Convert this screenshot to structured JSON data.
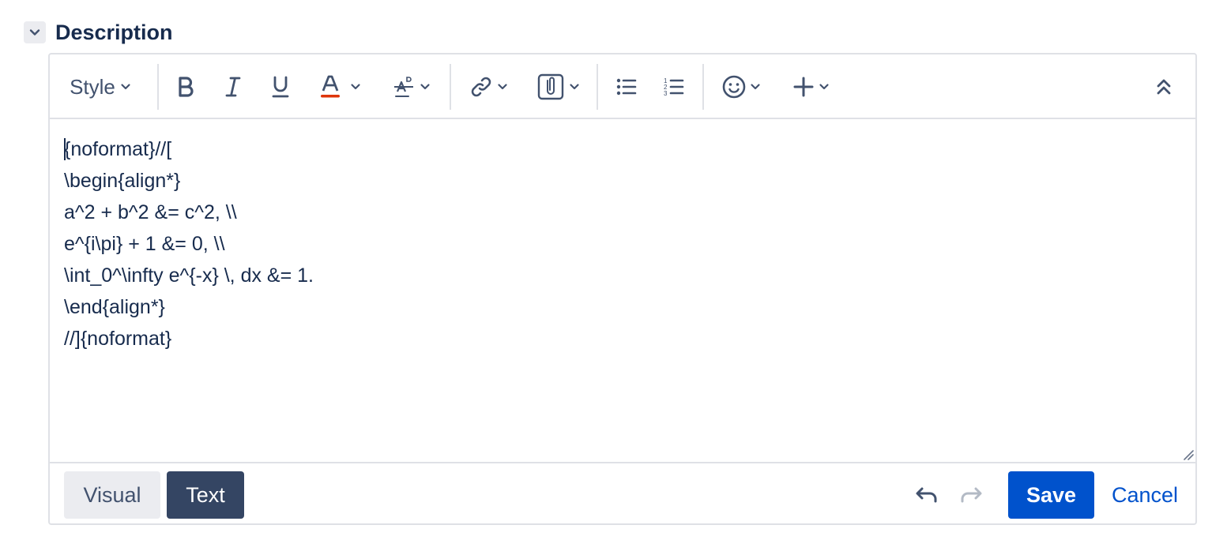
{
  "section": {
    "title": "Description",
    "toggle_icon": "chevron-down-icon"
  },
  "toolbar": {
    "style_label": "Style",
    "items": [
      {
        "name": "bold",
        "icon": "bold-icon"
      },
      {
        "name": "italic",
        "icon": "italic-icon"
      },
      {
        "name": "underline",
        "icon": "underline-icon"
      },
      {
        "name": "text-color",
        "icon": "text-color-icon"
      },
      {
        "name": "more-formatting",
        "icon": "text-format-icon"
      },
      {
        "name": "link",
        "icon": "link-icon"
      },
      {
        "name": "attachment",
        "icon": "attachment-icon"
      },
      {
        "name": "bullet-list",
        "icon": "bullet-list-icon"
      },
      {
        "name": "numbered-list",
        "icon": "numbered-list-icon"
      },
      {
        "name": "emoji",
        "icon": "emoji-icon"
      },
      {
        "name": "insert-more",
        "icon": "plus-icon"
      },
      {
        "name": "collapse-toolbar",
        "icon": "double-chevron-up-icon"
      }
    ],
    "text_color_accent": "#de350b"
  },
  "editor": {
    "lines": [
      "{noformat}//[",
      "\\begin{align*}",
      "a^2 + b^2 &= c^2, \\\\",
      "e^{i\\pi} + 1 &= 0, \\\\",
      "\\int_0^\\infty e^{-x} \\, dx &= 1.",
      "\\end{align*}",
      "//]{noformat}"
    ]
  },
  "footer": {
    "visual_label": "Visual",
    "text_label": "Text",
    "active_mode": "Text",
    "save_label": "Save",
    "cancel_label": "Cancel"
  },
  "colors": {
    "primary": "#0052cc",
    "text": "#172b4d",
    "active_tab": "#344563",
    "border": "#dfe1e6"
  }
}
